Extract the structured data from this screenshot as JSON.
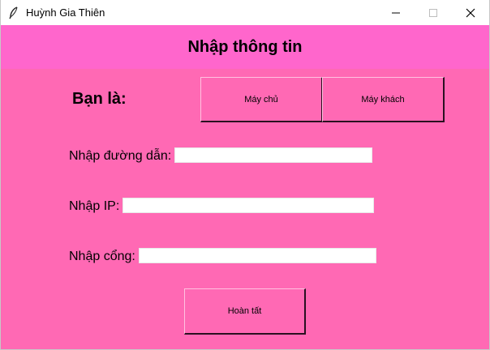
{
  "window": {
    "title": "Huỳnh Gia Thiên",
    "controls": [
      "minimize-icon",
      "maximize-icon",
      "close-icon"
    ]
  },
  "header": {
    "title": "Nhập thông tin"
  },
  "role": {
    "label": "Bạn là:",
    "server_button": "Máy chủ",
    "client_button": "Máy khách"
  },
  "fields": {
    "path_label": "Nhập đường dẫn:",
    "path_value": "",
    "ip_label": "Nhập IP:",
    "ip_value": "",
    "port_label": "Nhập cổng:",
    "port_value": ""
  },
  "actions": {
    "done_button": "Hoàn tất"
  },
  "colors": {
    "background": "#ff69b4",
    "header": "#ff66cc"
  }
}
